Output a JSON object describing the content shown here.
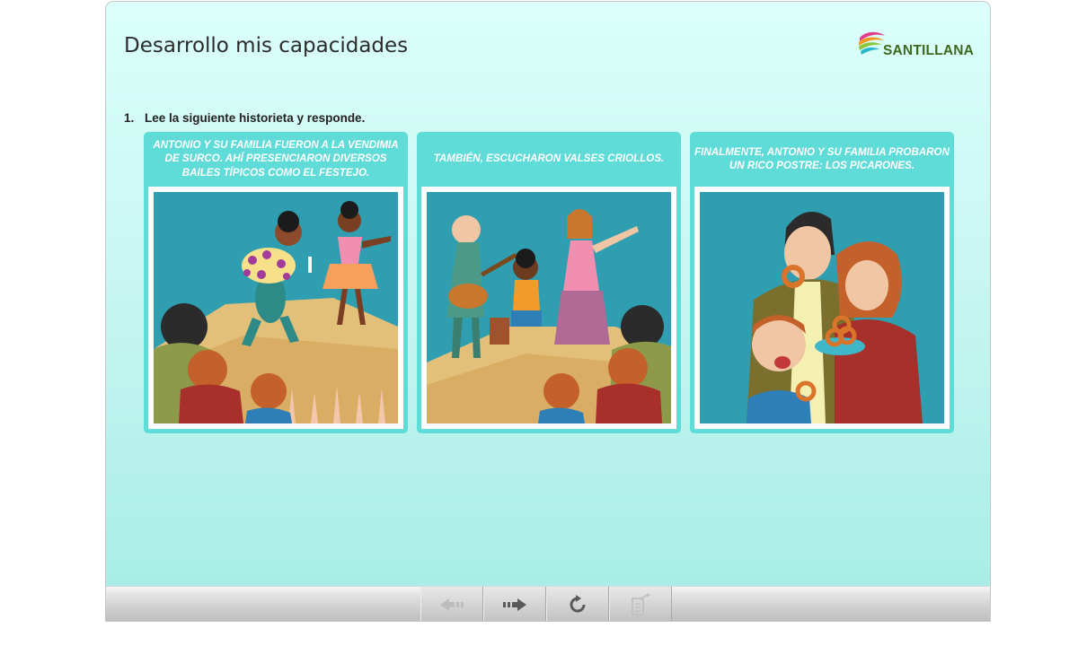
{
  "page": {
    "title": "Desarrollo mis capacidades",
    "brand": "SANTILLANA"
  },
  "activity": {
    "number": "1.",
    "instruction": "Lee la siguiente historieta y responde."
  },
  "panels": [
    {
      "caption": "ANTONIO Y SU FAMILIA FUERON A LA VENDIMIA DE SURCO. AHÍ PRESENCIARON DIVERSOS BAILES TÍPICOS COMO EL FESTEJO.",
      "image": "festejo-dance-illustration"
    },
    {
      "caption": "TAMBIÉN, ESCUCHARON VALSES CRIOLLOS.",
      "image": "criollo-waltz-singers-illustration"
    },
    {
      "caption": "FINALMENTE, ANTONIO Y SU FAMILIA PROBARON UN RICO POSTRE: LOS PICARONES.",
      "image": "family-eating-picarones-illustration"
    }
  ],
  "toolbar": {
    "buttons": [
      {
        "name": "previous",
        "icon": "arrow-left-icon",
        "enabled": false
      },
      {
        "name": "next",
        "icon": "arrow-right-icon",
        "enabled": true
      },
      {
        "name": "reset",
        "icon": "reload-icon",
        "enabled": true
      },
      {
        "name": "send",
        "icon": "export-document-icon",
        "enabled": false
      }
    ]
  },
  "colors": {
    "panel": "#5fdbd8",
    "background_top": "#dcfffb",
    "background_bottom": "#a6ece6",
    "brand_green": "#3d6a1f"
  }
}
